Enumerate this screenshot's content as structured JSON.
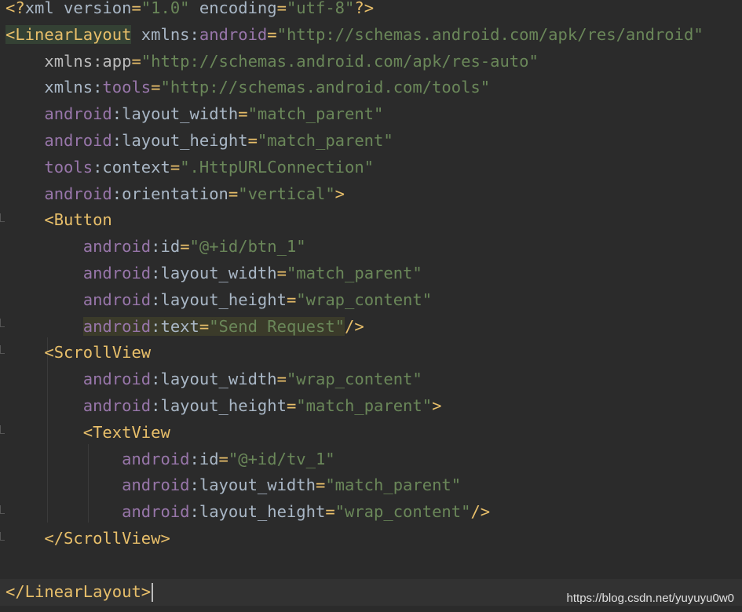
{
  "editor": {
    "lines": [
      {
        "parts": [
          [
            "t-xmldecl",
            "<?"
          ],
          [
            "t-plain",
            "xml version"
          ],
          [
            "t-punct",
            "="
          ],
          [
            "t-val",
            "\"1.0\""
          ],
          [
            "t-plain",
            " encoding"
          ],
          [
            "t-punct",
            "="
          ],
          [
            "t-val",
            "\"utf-8\""
          ],
          [
            "t-xmldecl",
            "?>"
          ]
        ]
      },
      {
        "parts": [
          [
            "t-tag",
            "<LinearLayout"
          ],
          [
            "t-plain",
            " xmlns:"
          ],
          [
            "t-ns",
            "android"
          ],
          [
            "t-punct",
            "="
          ],
          [
            "t-val",
            "\"http://schemas.android.com/apk/res/android\""
          ]
        ]
      },
      {
        "parts": [
          [
            "t-plain",
            "    "
          ],
          [
            "t-attr",
            "xmlns:app"
          ],
          [
            "t-punct",
            "="
          ],
          [
            "t-val",
            "\"http://schemas.android.com/apk/res-auto\""
          ]
        ]
      },
      {
        "parts": [
          [
            "t-plain",
            "    xmlns:"
          ],
          [
            "t-ns",
            "tools"
          ],
          [
            "t-punct",
            "="
          ],
          [
            "t-val",
            "\"http://schemas.android.com/tools\""
          ]
        ]
      },
      {
        "parts": [
          [
            "t-plain",
            "    "
          ],
          [
            "t-ns",
            "android"
          ],
          [
            "t-plain",
            ":layout_width"
          ],
          [
            "t-punct",
            "="
          ],
          [
            "t-val",
            "\"match_parent\""
          ]
        ]
      },
      {
        "parts": [
          [
            "t-plain",
            "    "
          ],
          [
            "t-ns",
            "android"
          ],
          [
            "t-plain",
            ":layout_height"
          ],
          [
            "t-punct",
            "="
          ],
          [
            "t-val",
            "\"match_parent\""
          ]
        ]
      },
      {
        "parts": [
          [
            "t-plain",
            "    "
          ],
          [
            "t-ns",
            "tools"
          ],
          [
            "t-plain",
            ":context"
          ],
          [
            "t-punct",
            "="
          ],
          [
            "t-val",
            "\".HttpURLConnection\""
          ]
        ]
      },
      {
        "parts": [
          [
            "t-plain",
            "    "
          ],
          [
            "t-ns",
            "android"
          ],
          [
            "t-plain",
            ":orientation"
          ],
          [
            "t-punct",
            "="
          ],
          [
            "t-val",
            "\"vertical\""
          ],
          [
            "t-tag",
            ">"
          ]
        ]
      },
      {
        "parts": [
          [
            "t-plain",
            "    "
          ],
          [
            "t-tag",
            "<Button"
          ]
        ]
      },
      {
        "parts": [
          [
            "t-plain",
            "        "
          ],
          [
            "t-ns",
            "android"
          ],
          [
            "t-plain",
            ":id"
          ],
          [
            "t-punct",
            "="
          ],
          [
            "t-val",
            "\"@+id/btn_1\""
          ]
        ]
      },
      {
        "parts": [
          [
            "t-plain",
            "        "
          ],
          [
            "t-ns",
            "android"
          ],
          [
            "t-plain",
            ":layout_width"
          ],
          [
            "t-punct",
            "="
          ],
          [
            "t-val",
            "\"match_parent\""
          ]
        ]
      },
      {
        "parts": [
          [
            "t-plain",
            "        "
          ],
          [
            "t-ns",
            "android"
          ],
          [
            "t-plain",
            ":layout_height"
          ],
          [
            "t-punct",
            "="
          ],
          [
            "t-val",
            "\"wrap_content\""
          ]
        ]
      },
      {
        "parts": [
          [
            "t-plain",
            "        "
          ],
          [
            "t-ns hl-attr",
            "android"
          ],
          [
            "t-plain hl-attr",
            ":text"
          ],
          [
            "t-punct hl-attr",
            "="
          ],
          [
            "t-val hl-attr",
            "\"Send Request\""
          ],
          [
            "t-tag",
            "/>"
          ]
        ]
      },
      {
        "parts": [
          [
            "t-plain",
            "    "
          ],
          [
            "t-tag",
            "<ScrollView"
          ]
        ]
      },
      {
        "parts": [
          [
            "t-plain",
            "        "
          ],
          [
            "t-ns",
            "android"
          ],
          [
            "t-plain",
            ":layout_width"
          ],
          [
            "t-punct",
            "="
          ],
          [
            "t-val",
            "\"wrap_content\""
          ]
        ]
      },
      {
        "parts": [
          [
            "t-plain",
            "        "
          ],
          [
            "t-ns",
            "android"
          ],
          [
            "t-plain",
            ":layout_height"
          ],
          [
            "t-punct",
            "="
          ],
          [
            "t-val",
            "\"match_parent\""
          ],
          [
            "t-tag",
            ">"
          ]
        ]
      },
      {
        "parts": [
          [
            "t-plain",
            "        "
          ],
          [
            "t-tag",
            "<TextView"
          ]
        ]
      },
      {
        "parts": [
          [
            "t-plain",
            "            "
          ],
          [
            "t-ns",
            "android"
          ],
          [
            "t-plain",
            ":id"
          ],
          [
            "t-punct",
            "="
          ],
          [
            "t-val",
            "\"@+id/tv_1\""
          ]
        ]
      },
      {
        "parts": [
          [
            "t-plain",
            "            "
          ],
          [
            "t-ns",
            "android"
          ],
          [
            "t-plain",
            ":layout_width"
          ],
          [
            "t-punct",
            "="
          ],
          [
            "t-val",
            "\"match_parent\""
          ]
        ]
      },
      {
        "parts": [
          [
            "t-plain",
            "            "
          ],
          [
            "t-ns",
            "android"
          ],
          [
            "t-plain",
            ":layout_height"
          ],
          [
            "t-punct",
            "="
          ],
          [
            "t-val",
            "\"wrap_content\""
          ],
          [
            "t-tag",
            "/>"
          ]
        ]
      },
      {
        "parts": [
          [
            "t-plain",
            "    "
          ],
          [
            "t-tag",
            "</ScrollView>"
          ]
        ]
      },
      {
        "parts": []
      },
      {
        "parts": [
          [
            "t-tag",
            "</LinearLayout>"
          ]
        ]
      }
    ]
  },
  "watermark": "https://blog.csdn.net/yuyuyu0w0"
}
